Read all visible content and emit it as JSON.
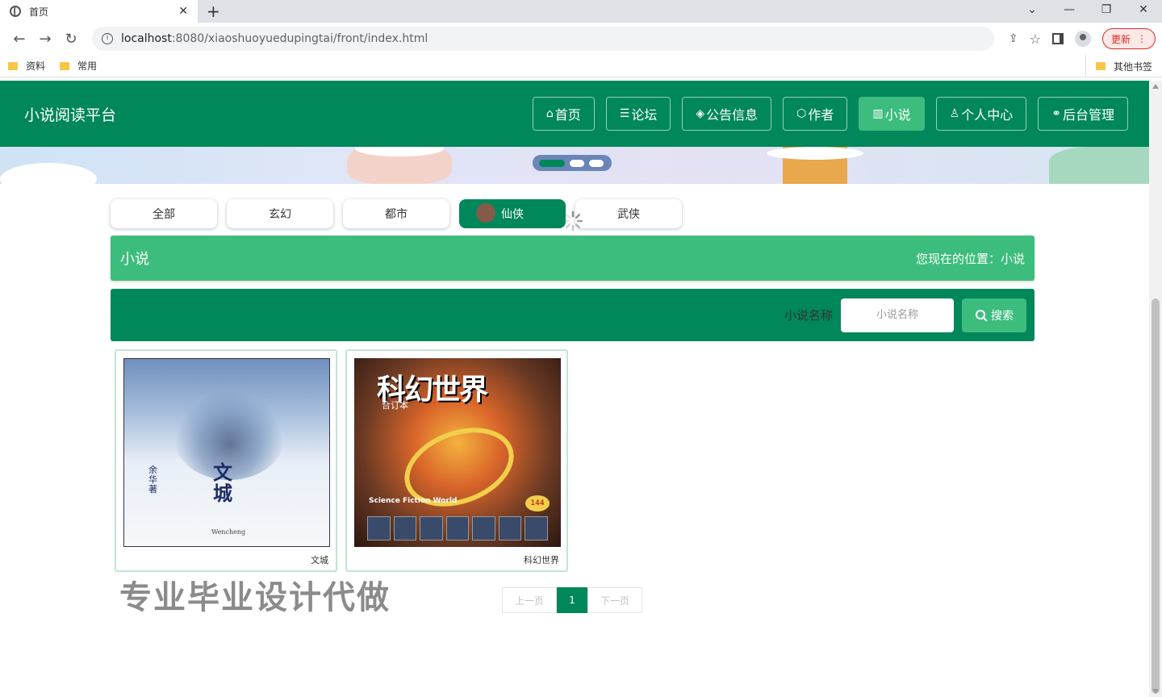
{
  "browser": {
    "tab_title": "首页",
    "tab_close": "✕",
    "new_tab": "+",
    "win_min": "—",
    "win_restore": "❐",
    "win_close": "✕",
    "url_host": "localhost",
    "url_path": ":8080/xiaoshuoyuedupingtai/front/index.html",
    "update_label": "更新",
    "bookmarks": [
      "资料",
      "常用"
    ],
    "other_bookmarks": "其他书签"
  },
  "header": {
    "brand": "小说阅读平台",
    "menu": [
      {
        "icon": "⌂",
        "label": "首页"
      },
      {
        "icon": "☰",
        "label": "论坛"
      },
      {
        "icon": "◈",
        "label": "公告信息"
      },
      {
        "icon": "⬡",
        "label": "作者"
      },
      {
        "icon": "▥",
        "label": "小说"
      },
      {
        "icon": "♙",
        "label": "个人中心"
      },
      {
        "icon": "⚭",
        "label": "后台管理"
      }
    ],
    "active_menu": "小说"
  },
  "categories": [
    "全部",
    "玄幻",
    "都市",
    "仙侠",
    "武侠"
  ],
  "active_category": "仙侠",
  "section": {
    "title": "小说",
    "location": "您现在的位置：小说"
  },
  "search": {
    "label": "小说名称",
    "placeholder": "小说名称",
    "button": "搜索"
  },
  "books": [
    {
      "name": "文城",
      "cover_title": "文城",
      "cover_author": "余华著",
      "cover_en": "Wencheng"
    },
    {
      "name": "科幻世界",
      "cover_title": "科幻世界",
      "cover_sub": "合订本",
      "cover_en": "Science Fiction World",
      "cover_badge": "144"
    }
  ],
  "watermark": "专业毕业设计代做",
  "pagination": {
    "prev": "上一页",
    "current": "1",
    "next": "下一页"
  },
  "colors": {
    "primary": "#00875a",
    "accent": "#3dbd7d"
  }
}
